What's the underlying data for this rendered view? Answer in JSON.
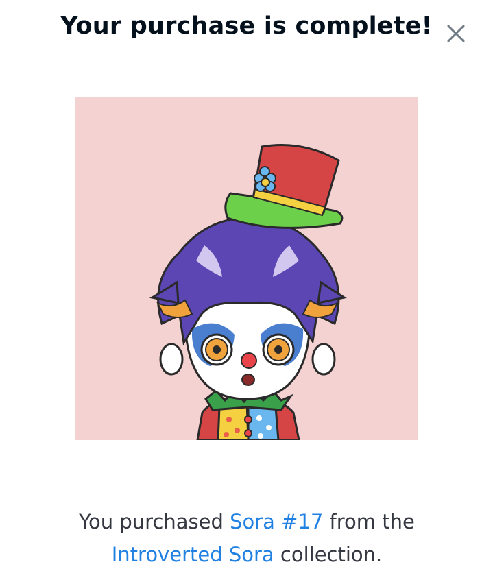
{
  "modal": {
    "title": "Your purchase is complete!",
    "close_icon": "close-icon",
    "image_background": "#f4d2d2"
  },
  "message": {
    "prefix": "You purchased ",
    "item_link": "Sora #17",
    "middle": " from the",
    "collection_link": "Introverted Sora",
    "suffix": " collection."
  },
  "colors": {
    "title": "#04111d",
    "link": "#2081e2",
    "text": "#353840",
    "close": "#707a83"
  }
}
